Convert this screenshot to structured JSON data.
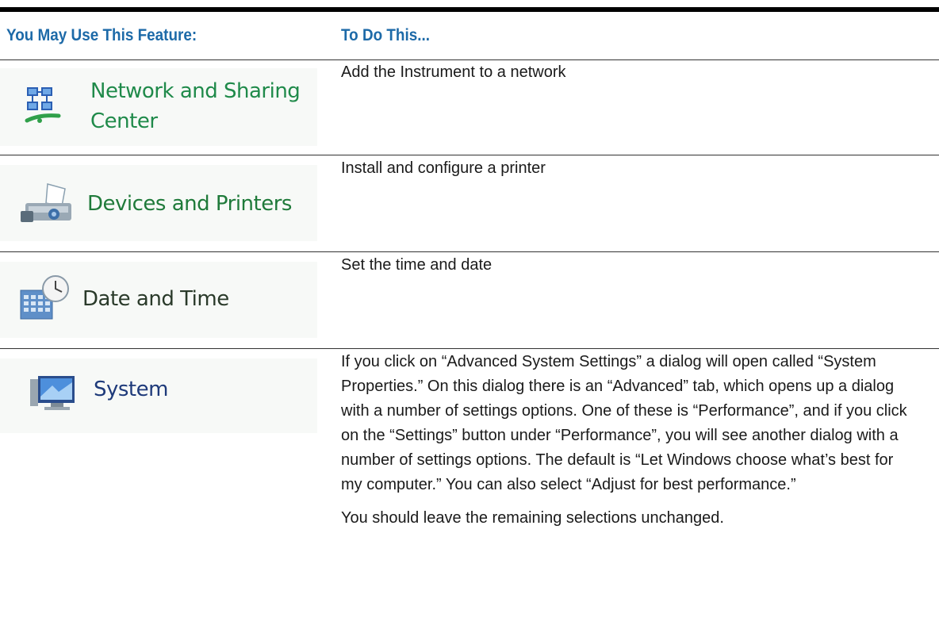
{
  "header": {
    "col1": "You May Use This Feature:",
    "col2": "To Do This..."
  },
  "rows": [
    {
      "feature": "Network and Sharing Center",
      "feature_lines": [
        "Network and Sharing",
        "Center"
      ],
      "icon": "network-icon",
      "description": [
        "Add the Instrument to a network"
      ]
    },
    {
      "feature": "Devices and Printers",
      "feature_lines": [
        "Devices and Printers"
      ],
      "icon": "printer-icon",
      "description": [
        "Install and configure a printer"
      ]
    },
    {
      "feature": "Date and Time",
      "feature_lines": [
        "Date and Time"
      ],
      "icon": "calendar-clock-icon",
      "description": [
        "Set the time and date"
      ]
    },
    {
      "feature": "System",
      "feature_lines": [
        "System"
      ],
      "icon": "system-monitor-icon",
      "description": [
        "If you click on “Advanced System Settings” a dialog will open called “System Properties.” On this dialog there is an “Advanced” tab, which opens up a dialog with a number of settings options. One of these is “Performance”, and if you click on the “Settings” button under “Performance”, you will see another dialog with a number of settings options.  The default is “Let Windows choose what’s best for my computer.” You can also select “Adjust for best performance.”",
        "You should leave the remaining selections unchanged."
      ]
    }
  ],
  "colors": {
    "header_text": "#1d6aa8",
    "network_label": "#1f8a4a",
    "devices_label": "#1f7a3a",
    "date_label": "#2a3a2a",
    "system_label": "#1e3a7a"
  }
}
